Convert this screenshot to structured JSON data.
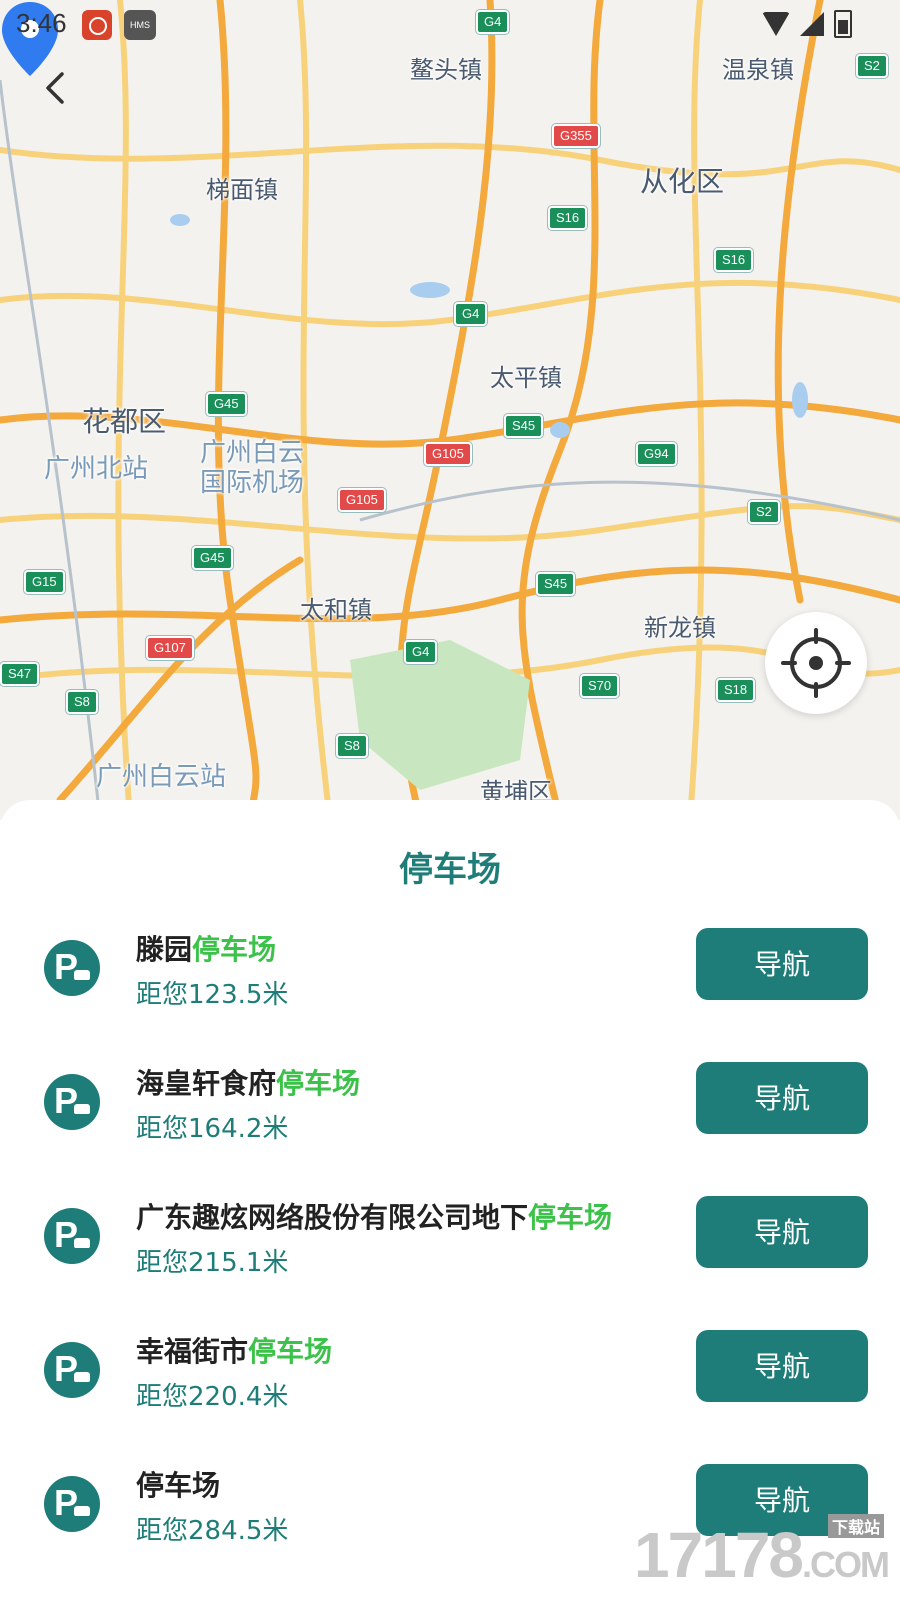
{
  "status_bar": {
    "time": "3:46",
    "app_badge": "HMS"
  },
  "map": {
    "place_labels": [
      {
        "text": "鳌头镇"
      },
      {
        "text": "温泉镇"
      },
      {
        "text": "梯面镇"
      },
      {
        "text": "从化区"
      },
      {
        "text": "太平镇"
      },
      {
        "text": "花都区"
      },
      {
        "text": "广州北站"
      },
      {
        "text": "广州白云"
      },
      {
        "text": "国际机场"
      },
      {
        "text": "太和镇"
      },
      {
        "text": "新龙镇"
      },
      {
        "text": "广州白云站"
      },
      {
        "text": "黄埔区"
      }
    ],
    "road_shields": [
      {
        "text": "G4",
        "type": "g"
      },
      {
        "text": "G355",
        "type": "r"
      },
      {
        "text": "S16",
        "type": "g"
      },
      {
        "text": "S16",
        "type": "g"
      },
      {
        "text": "G4",
        "type": "g"
      },
      {
        "text": "G45",
        "type": "g"
      },
      {
        "text": "G105",
        "type": "r"
      },
      {
        "text": "S45",
        "type": "g"
      },
      {
        "text": "G94",
        "type": "g"
      },
      {
        "text": "G105",
        "type": "r"
      },
      {
        "text": "S2",
        "type": "g"
      },
      {
        "text": "G45",
        "type": "g"
      },
      {
        "text": "G15",
        "type": "g"
      },
      {
        "text": "S45",
        "type": "g"
      },
      {
        "text": "G107",
        "type": "r"
      },
      {
        "text": "G4",
        "type": "g"
      },
      {
        "text": "S70",
        "type": "g"
      },
      {
        "text": "S18",
        "type": "g"
      },
      {
        "text": "S47",
        "type": "g"
      },
      {
        "text": "S8",
        "type": "g"
      },
      {
        "text": "S8",
        "type": "g"
      },
      {
        "text": "S2",
        "type": "g"
      }
    ]
  },
  "sheet": {
    "title": "停车场",
    "nav_label": "导航",
    "items": [
      {
        "name": "滕园",
        "highlight": "停车场",
        "distance": "距您123.5米"
      },
      {
        "name": "海皇轩食府",
        "highlight": "停车场",
        "distance": "距您164.2米"
      },
      {
        "name": "广东趣炫网络股份有限公司地下",
        "highlight": "停车场",
        "distance": "距您215.1米"
      },
      {
        "name": "幸福街市",
        "highlight": "停车场",
        "distance": "距您220.4米"
      },
      {
        "name": "停车场",
        "highlight": "",
        "distance": "距您284.5米"
      }
    ]
  },
  "watermark": {
    "text": "17178",
    "sub": "下载站",
    "suffix": ".COM"
  },
  "colors": {
    "accent": "#1e7d78",
    "highlight": "#3cc24a",
    "road": "#f5b041",
    "park": "#c8e6c0"
  }
}
